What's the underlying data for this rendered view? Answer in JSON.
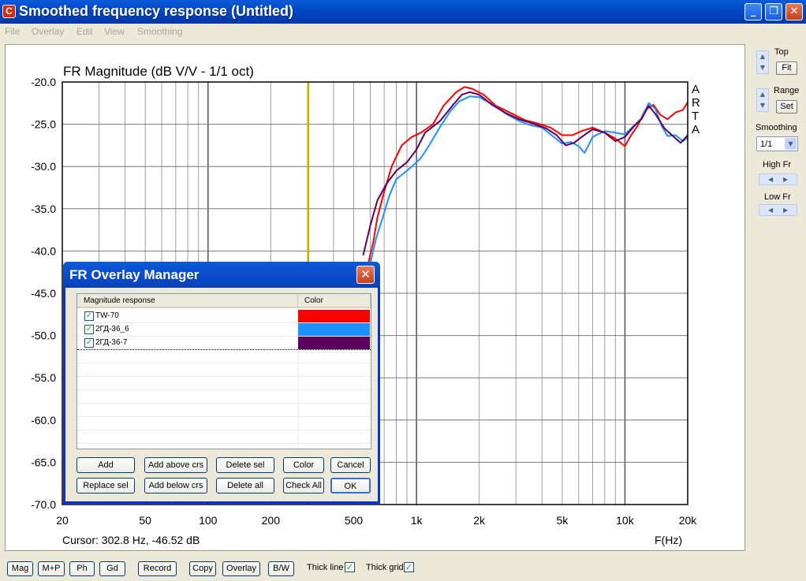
{
  "window": {
    "title": "Smoothed frequency response (Untitled)",
    "app_icon_letter": "C"
  },
  "menu": [
    "File",
    "Overlay",
    "Edit",
    "View",
    "Smoothing"
  ],
  "plot": {
    "title": "FR Magnitude (dB V/V - 1/1 oct)",
    "y_ticks": [
      "-20.0",
      "-25.0",
      "-30.0",
      "-35.0",
      "-40.0",
      "-45.0",
      "-50.0",
      "-55.0",
      "-60.0",
      "-65.0",
      "-70.0"
    ],
    "x_ticks": [
      "20",
      "50",
      "100",
      "200",
      "500",
      "1k",
      "2k",
      "5k",
      "10k",
      "20k"
    ],
    "x_unit": "F(Hz)",
    "cursor_text": "Cursor: 302.8 Hz, -46.52 dB",
    "watermark": [
      "A",
      "R",
      "T",
      "A"
    ]
  },
  "chart_data": {
    "type": "line",
    "title": "FR Magnitude (dB V/V - 1/1 oct)",
    "xlabel": "F(Hz)",
    "ylabel": "",
    "x_scale": "log",
    "xlim": [
      20,
      20000
    ],
    "ylim": [
      -70,
      -20
    ],
    "grid": true,
    "cursor": {
      "x": 302.8,
      "y": -46.52,
      "color": "#c8b400"
    },
    "series": [
      {
        "name": "TW-70",
        "color": "#ff0000",
        "points": [
          [
            580,
            -42
          ],
          [
            620,
            -39
          ],
          [
            650,
            -36
          ],
          [
            700,
            -33
          ],
          [
            760,
            -30
          ],
          [
            850,
            -27.5
          ],
          [
            950,
            -26.5
          ],
          [
            1050,
            -26
          ],
          [
            1200,
            -25
          ],
          [
            1350,
            -22.8
          ],
          [
            1550,
            -21.2
          ],
          [
            1700,
            -20.6
          ],
          [
            1850,
            -20.8
          ],
          [
            2100,
            -21.5
          ],
          [
            2400,
            -22.8
          ],
          [
            2800,
            -23.6
          ],
          [
            3300,
            -24.5
          ],
          [
            3800,
            -24.9
          ],
          [
            4400,
            -25.4
          ],
          [
            5000,
            -26.3
          ],
          [
            5600,
            -26.3
          ],
          [
            6200,
            -25.8
          ],
          [
            7000,
            -25.4
          ],
          [
            8000,
            -26
          ],
          [
            9000,
            -26.7
          ],
          [
            10000,
            -27.6
          ],
          [
            10700,
            -26.3
          ],
          [
            11500,
            -25.2
          ],
          [
            12500,
            -23.3
          ],
          [
            13700,
            -22.7
          ],
          [
            14800,
            -23.9
          ],
          [
            16000,
            -24.4
          ],
          [
            17500,
            -23.6
          ],
          [
            19000,
            -23.3
          ],
          [
            20000,
            -22.4
          ]
        ]
      },
      {
        "name": "2ГД-36_6",
        "color": "#1e90ff",
        "points": [
          [
            600,
            -41.5
          ],
          [
            640,
            -38.5
          ],
          [
            690,
            -36
          ],
          [
            740,
            -33.5
          ],
          [
            800,
            -31.5
          ],
          [
            900,
            -30.5
          ],
          [
            950,
            -30
          ],
          [
            1050,
            -29
          ],
          [
            1150,
            -27.5
          ],
          [
            1300,
            -25.3
          ],
          [
            1450,
            -23.5
          ],
          [
            1600,
            -22.3
          ],
          [
            1800,
            -21.7
          ],
          [
            2000,
            -21.8
          ],
          [
            2300,
            -22.6
          ],
          [
            2700,
            -23.8
          ],
          [
            3100,
            -24.6
          ],
          [
            3500,
            -25.1
          ],
          [
            4000,
            -25.4
          ],
          [
            4500,
            -26.4
          ],
          [
            5000,
            -27.3
          ],
          [
            5500,
            -27.1
          ],
          [
            6000,
            -27.6
          ],
          [
            6400,
            -28.4
          ],
          [
            7000,
            -26.5
          ],
          [
            8000,
            -25.8
          ],
          [
            9000,
            -26
          ],
          [
            10000,
            -26.2
          ],
          [
            11000,
            -25.2
          ],
          [
            12000,
            -24.3
          ],
          [
            13000,
            -22.5
          ],
          [
            14000,
            -23.2
          ],
          [
            15000,
            -25.2
          ],
          [
            16000,
            -26.4
          ],
          [
            17500,
            -26.3
          ],
          [
            19000,
            -27
          ],
          [
            20000,
            -26.6
          ]
        ]
      },
      {
        "name": "2ГД-36-7",
        "color": "#5c0060",
        "points": [
          [
            555,
            -40.5
          ],
          [
            600,
            -37
          ],
          [
            650,
            -34
          ],
          [
            720,
            -32
          ],
          [
            800,
            -30.5
          ],
          [
            900,
            -29.5
          ],
          [
            1000,
            -28
          ],
          [
            1100,
            -26
          ],
          [
            1300,
            -24.6
          ],
          [
            1500,
            -22.7
          ],
          [
            1650,
            -21.5
          ],
          [
            1800,
            -21.2
          ],
          [
            2000,
            -21.5
          ],
          [
            2300,
            -22.7
          ],
          [
            2700,
            -23.7
          ],
          [
            3100,
            -24.4
          ],
          [
            3600,
            -24.9
          ],
          [
            4200,
            -25.5
          ],
          [
            4700,
            -26.3
          ],
          [
            5200,
            -27.5
          ],
          [
            5700,
            -27.2
          ],
          [
            6200,
            -26.5
          ],
          [
            7000,
            -25.6
          ],
          [
            8000,
            -26
          ],
          [
            9000,
            -27
          ],
          [
            10000,
            -26.5
          ],
          [
            11000,
            -25.3
          ],
          [
            12000,
            -24.4
          ],
          [
            13000,
            -22.8
          ],
          [
            14000,
            -23.8
          ],
          [
            15500,
            -25.5
          ],
          [
            17000,
            -26.4
          ],
          [
            18500,
            -27.2
          ],
          [
            20000,
            -26.3
          ]
        ]
      }
    ]
  },
  "side": {
    "top_label": "Top",
    "fit_label": "Fit",
    "range_label": "Range",
    "set_label": "Set",
    "smoothing_label": "Smoothing",
    "smoothing_value": "1/1",
    "high_fr_label": "High Fr",
    "low_fr_label": "Low Fr"
  },
  "bottom": {
    "buttons": [
      "Mag",
      "M+P",
      "Ph",
      "Gd",
      "Record",
      "Copy",
      "Overlay",
      "B/W"
    ],
    "thick_line_label": "Thick line",
    "thick_grid_label": "Thick grid"
  },
  "dialog": {
    "title": "FR Overlay Manager",
    "col_response": "Magnitude response",
    "col_color": "Color",
    "rows": [
      {
        "name": "TW-70",
        "color": "#ff0000"
      },
      {
        "name": "2ГД-36_6",
        "color": "#1e90ff"
      },
      {
        "name": "2ГД-36-7",
        "color": "#5c0060"
      }
    ],
    "buttons_row1": [
      "Add",
      "Add above crs",
      "Delete sel",
      "Color",
      "Cancel"
    ],
    "buttons_row2": [
      "Replace sel",
      "Add below crs",
      "Delete all",
      "Check All",
      "OK"
    ]
  }
}
